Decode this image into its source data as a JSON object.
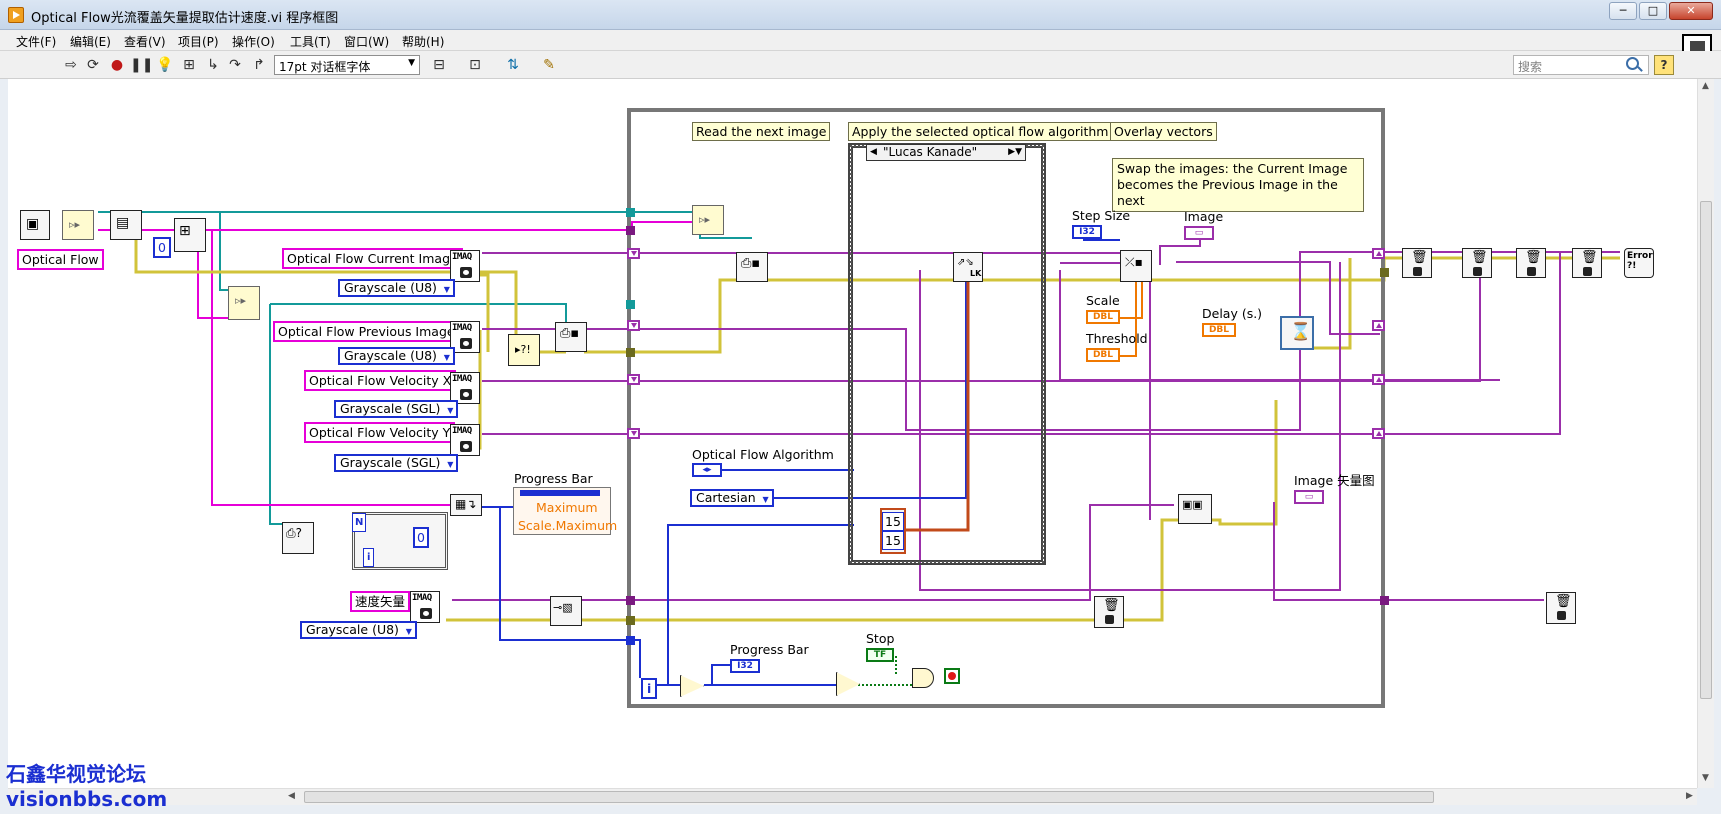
{
  "window": {
    "title": "Optical Flow光流覆盖矢量提取估计速度.vi 程序框图",
    "minimize": "─",
    "maximize": "□",
    "close": "✕"
  },
  "menu": [
    "文件(F)",
    "编辑(E)",
    "查看(V)",
    "项目(P)",
    "操作(O)",
    "工具(T)",
    "窗口(W)",
    "帮助(H)"
  ],
  "toolbar": {
    "font": "17pt 对话框字体",
    "search_placeholder": "搜索",
    "help": "?",
    "icons": [
      "run-arrow-icon",
      "run-continuously-icon",
      "abort-icon",
      "pause-icon",
      "highlight-execution-icon",
      "retain-wire-values-icon",
      "step-into-icon",
      "step-over-icon",
      "step-out-icon",
      "align-icon",
      "distribute-icon",
      "reorder-icon",
      "cleanup-icon"
    ]
  },
  "comments": {
    "read": "Read the next image",
    "apply": "Apply the selected optical flow algorithm",
    "overlay": "Overlay vectors",
    "swap": "Swap the images: the Current Image becomes the Previous Image in the next"
  },
  "labels": {
    "optical_flow": "Optical Flow",
    "current_image": "Optical Flow Current Image",
    "previous_image": "Optical Flow Previous Image",
    "velocity_x": "Optical Flow Velocity X",
    "velocity_y": "Optical Flow Velocity Y",
    "velocity_vector": "速度矢量",
    "progress_bar": "Progress Bar",
    "maximum": "Maximum",
    "scale_maximum": "Scale.Maximum",
    "optical_flow_algorithm": "Optical Flow Algorithm",
    "step_size": "Step Size",
    "image": "Image",
    "scale": "Scale",
    "threshold": "Threshold",
    "delay": "Delay (s.)",
    "image_vector": "Image 矢量图",
    "stop": "Stop",
    "progress_bar_inner": "Progress Bar"
  },
  "constants": {
    "gray_u8": "Grayscale (U8)",
    "gray_sgl": "Grayscale (SGL)",
    "cartesian": "Cartesian",
    "zero": "0",
    "win_15a": "15",
    "win_15b": "15",
    "case_value": "\"Lucas Kanade\"",
    "n_label": "N",
    "i_label": "i",
    "imaq": "IMAQ"
  },
  "terminals": {
    "i32": "I32",
    "dbl": "DBL",
    "tf": "TF",
    "img": "▭",
    "enum": "◂▸"
  },
  "watermark": {
    "line1": "石鑫华视觉论坛",
    "line2": "visionbbs.com"
  },
  "colors": {
    "image_wire": "#9b2faa",
    "error_wire": "#d1c33a",
    "int_wire": "#1b2fd1",
    "float_wire": "#f07800",
    "label_highlight": "#e600d8"
  }
}
